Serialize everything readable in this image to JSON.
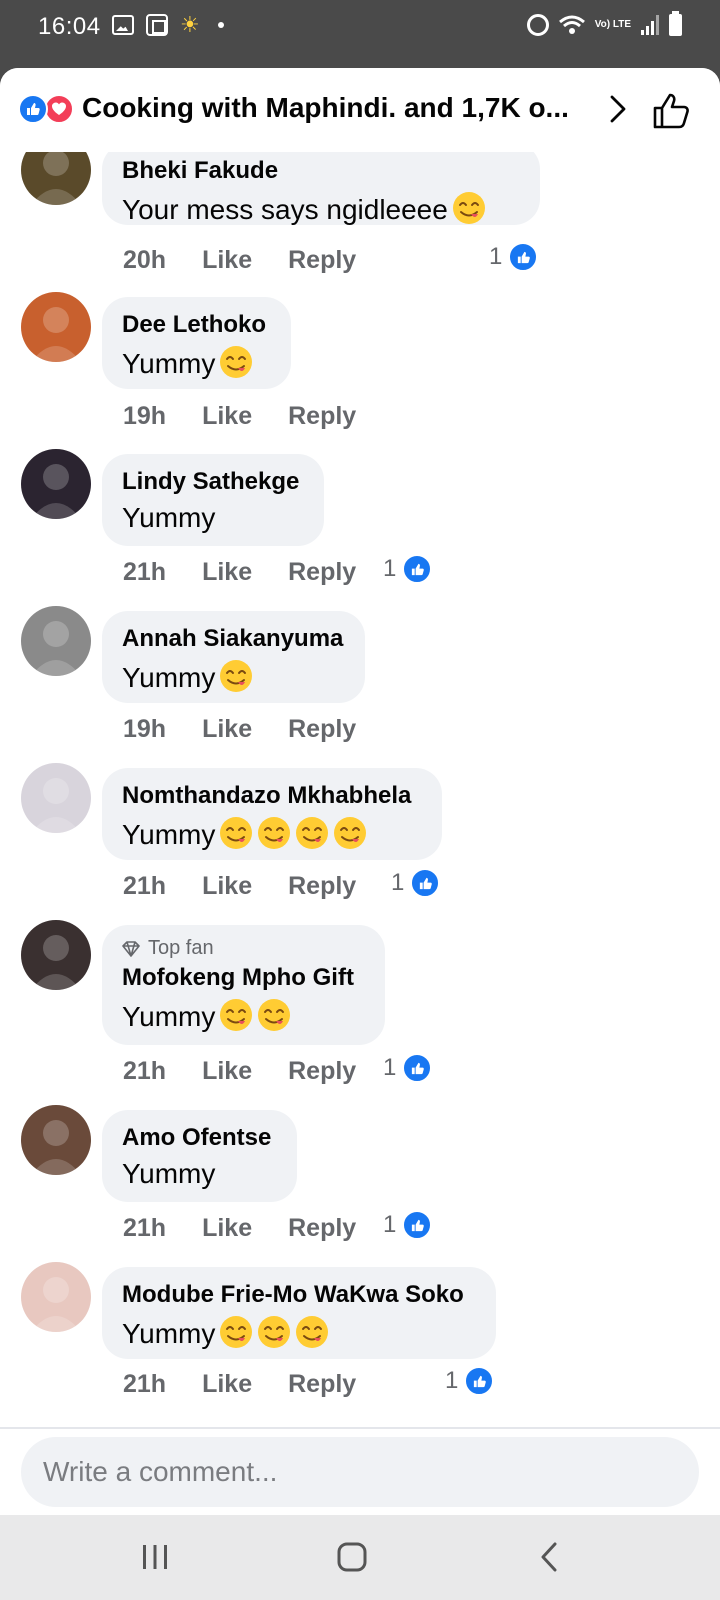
{
  "status_bar": {
    "time": "16:04",
    "lte_label": "Vo) LTE"
  },
  "header": {
    "title": "Cooking with Maphindi. and 1,7K o...",
    "reaction_icons": [
      "like-icon",
      "love-icon"
    ]
  },
  "comments": [
    {
      "name": "Bheki Fakude",
      "text": "Your mess says ngidleeee",
      "emoji_count": 1,
      "time": "20h",
      "like_label": "Like",
      "reply_label": "Reply",
      "reactions": "1",
      "avatar_color": "#5a4a2a"
    },
    {
      "name": "Dee Lethoko",
      "text": "Yummy",
      "emoji_count": 1,
      "time": "19h",
      "like_label": "Like",
      "reply_label": "Reply",
      "reactions": "",
      "avatar_color": "#c8602e"
    },
    {
      "name": "Lindy Sathekge",
      "text": "Yummy",
      "emoji_count": 0,
      "time": "21h",
      "like_label": "Like",
      "reply_label": "Reply",
      "reactions": "1",
      "avatar_color": "#2b2430"
    },
    {
      "name": "Annah Siakanyuma",
      "text": "Yummy",
      "emoji_count": 1,
      "time": "19h",
      "like_label": "Like",
      "reply_label": "Reply",
      "reactions": "",
      "avatar_color": "#8a8a8a"
    },
    {
      "name": "Nomthandazo Mkhabhela",
      "text": "Yummy",
      "emoji_count": 4,
      "time": "21h",
      "like_label": "Like",
      "reply_label": "Reply",
      "reactions": "1",
      "avatar_color": "#d8d4dc"
    },
    {
      "name": "Mofokeng Mpho Gift",
      "badge": "Top fan",
      "text": "Yummy",
      "emoji_count": 2,
      "time": "21h",
      "like_label": "Like",
      "reply_label": "Reply",
      "reactions": "1",
      "avatar_color": "#3a3030"
    },
    {
      "name": "Amo Ofentse",
      "text": "Yummy",
      "emoji_count": 0,
      "time": "21h",
      "like_label": "Like",
      "reply_label": "Reply",
      "reactions": "1",
      "avatar_color": "#6a4a3a"
    },
    {
      "name": "Modube Frie-Mo WaKwa Soko",
      "text": "Yummy",
      "emoji_count": 3,
      "time": "21h",
      "like_label": "Like",
      "reply_label": "Reply",
      "reactions": "1",
      "avatar_color": "#e8c8c0"
    }
  ],
  "composer": {
    "placeholder": "Write a comment..."
  },
  "colors": {
    "brand_blue": "#1877f2",
    "love_red": "#f33e58",
    "bubble_bg": "#f0f2f5",
    "meta_gray": "#65676b"
  }
}
